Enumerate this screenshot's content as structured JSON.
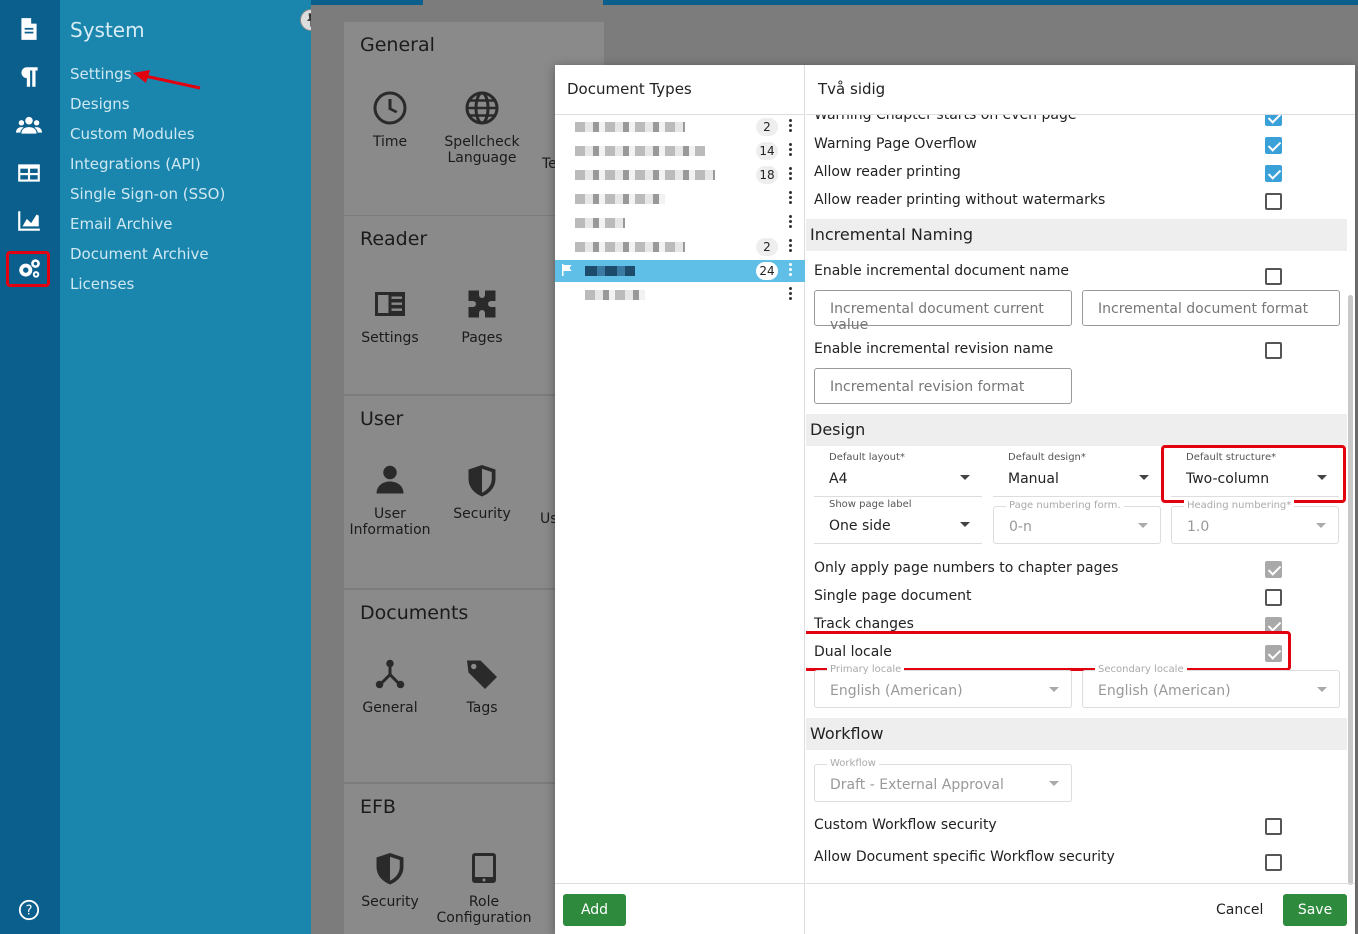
{
  "rail": {
    "icons": [
      "document-icon",
      "paragraph-icon",
      "users-icon",
      "table-icon",
      "chart-icon",
      "settings-gears-icon",
      "help-icon"
    ]
  },
  "sysnav": {
    "title": "System",
    "items": [
      "Settings",
      "Designs",
      "Custom Modules",
      "Integrations (API)",
      "Single Sign-on (SSO)",
      "Email Archive",
      "Document Archive",
      "Licenses"
    ]
  },
  "main": {
    "sections": [
      {
        "title": "General",
        "tiles": [
          "Time",
          "Spellcheck Language"
        ],
        "partial": "Te"
      },
      {
        "title": "Reader",
        "tiles": [
          "Settings",
          "Pages"
        ]
      },
      {
        "title": "User",
        "tiles": [
          "User Information",
          "Security"
        ],
        "partial": "Us"
      },
      {
        "title": "Documents",
        "tiles": [
          "General",
          "Tags"
        ]
      },
      {
        "title": "EFB",
        "tiles": [
          "Security",
          "Role Configuration"
        ]
      }
    ]
  },
  "dialog": {
    "left_title": "Document Types",
    "counts": [
      "2",
      "14",
      "18",
      "2",
      "24"
    ],
    "add_label": "Add",
    "right_title": "Två sidig",
    "rows": {
      "warn_chapter": "Warning Chapter starts on even page",
      "warn_overflow": "Warning Page Overflow",
      "allow_print": "Allow reader printing",
      "allow_print_nowm": "Allow reader printing without watermarks"
    },
    "incremental": {
      "section": "Incremental Naming",
      "enable_doc": "Enable incremental document name",
      "cur_value_ph": "Incremental document current value",
      "format_ph": "Incremental document format",
      "enable_rev": "Enable incremental revision name",
      "rev_format_ph": "Incremental revision format"
    },
    "design": {
      "section": "Design",
      "default_layout_label": "Default layout*",
      "default_layout": "A4",
      "default_design_label": "Default design*",
      "default_design": "Manual",
      "default_structure_label": "Default structure*",
      "default_structure": "Two-column",
      "show_page_label_label": "Show page label",
      "show_page_label": "One side",
      "page_numbering_label": "Page numbering form.",
      "page_numbering": "0-n",
      "heading_numbering_label": "Heading numbering*",
      "heading_numbering": "1.0",
      "only_apply": "Only apply page numbers to chapter pages",
      "single_page": "Single page document",
      "track_changes": "Track changes",
      "dual_locale": "Dual locale",
      "primary_locale_label": "Primary locale",
      "primary_locale": "English (American)",
      "secondary_locale_label": "Secondary locale",
      "secondary_locale": "English (American)"
    },
    "workflow": {
      "section": "Workflow",
      "workflow_label": "Workflow",
      "workflow_value": "Draft - External Approval",
      "custom_security": "Custom Workflow security",
      "doc_specific": "Allow Document specific Workflow security"
    },
    "cancel_label": "Cancel",
    "save_label": "Save"
  },
  "colors": {
    "rail": "#0b5f8d",
    "sysnav": "#1a86ad",
    "save_green": "#2e8b3e",
    "check_blue": "#3aa0d8",
    "highlight_red": "#e3000f"
  }
}
